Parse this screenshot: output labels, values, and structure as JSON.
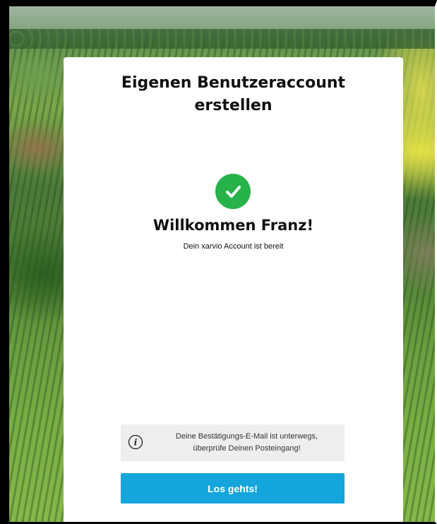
{
  "card": {
    "title": "Eigenen Benutzeraccount erstellen",
    "status_icon": "check-circle-icon",
    "welcome_heading": "Willkommen Franz!",
    "welcome_subtitle": "Dein xarvio Account ist bereit"
  },
  "notice": {
    "icon": "info-icon",
    "line1": "Deine Bestätigungs-E-Mail ist unterwegs,",
    "line2": "überprüfe Deinen Posteingang!"
  },
  "actions": {
    "primary_label": "Los gehts!"
  },
  "colors": {
    "success": "#27b24a",
    "primary": "#14a5dc",
    "notice_background": "#eeeeee"
  }
}
